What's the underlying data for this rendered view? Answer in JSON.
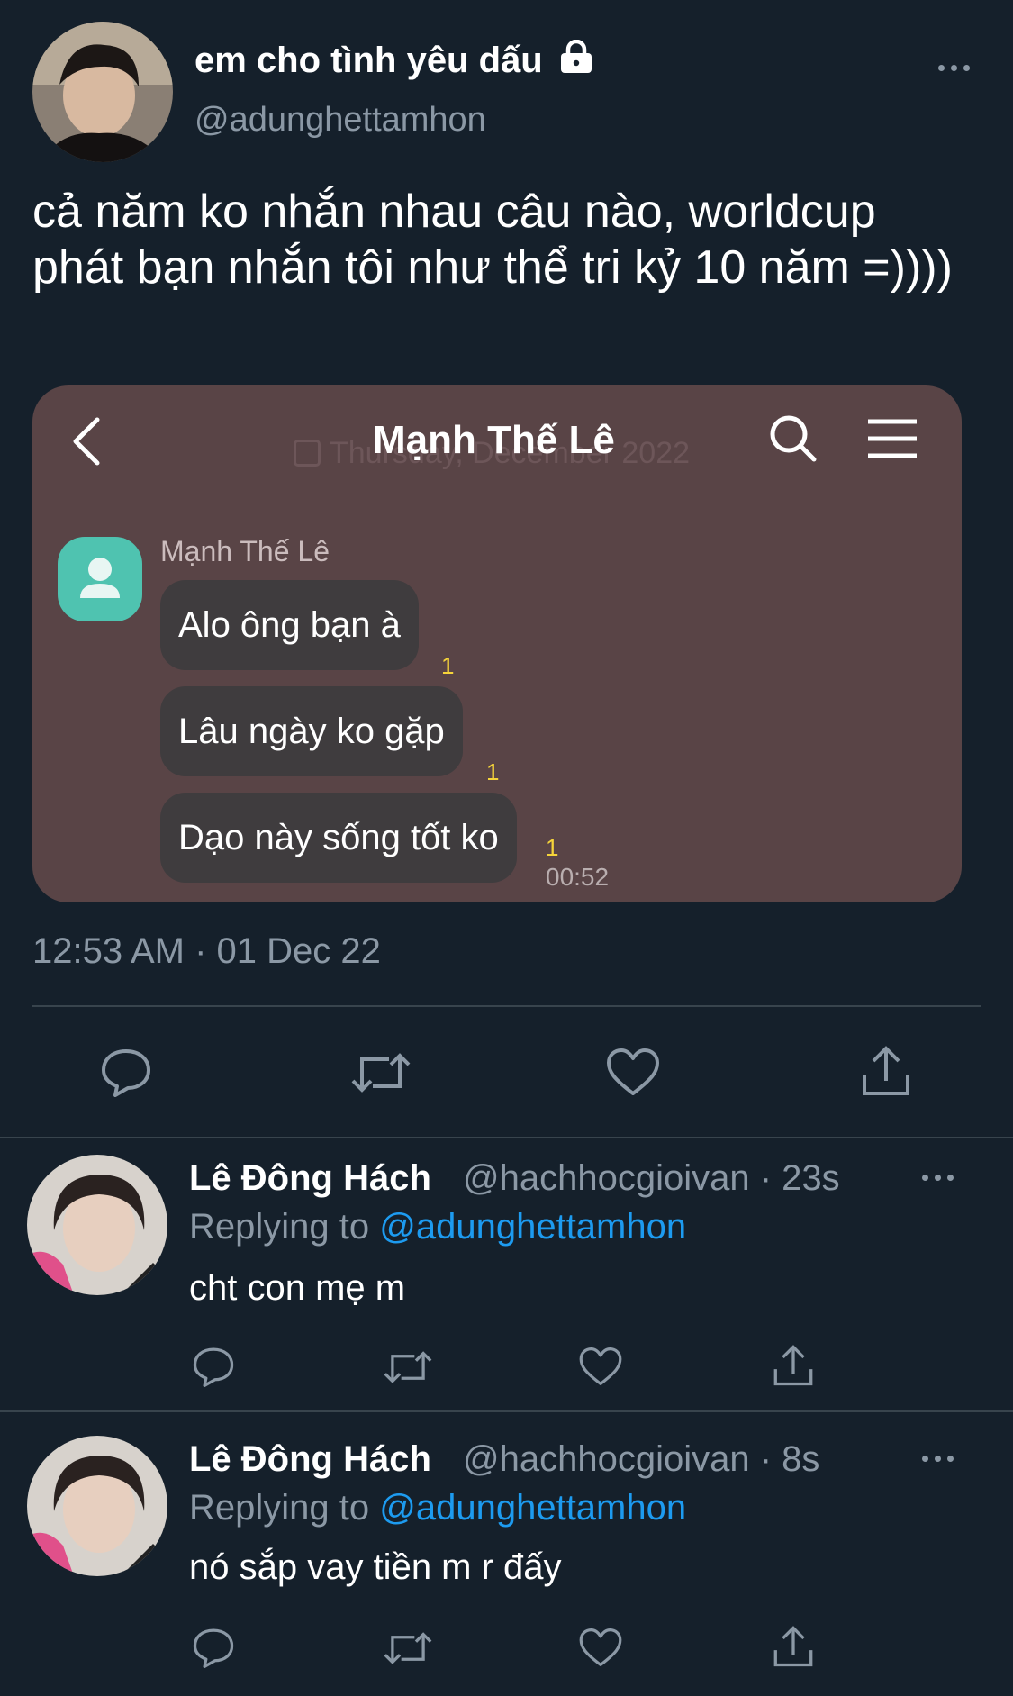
{
  "main_tweet": {
    "display_name": "em cho tình yêu dấu",
    "handle": "@adunghettamhon",
    "text": "cả năm ko nhắn nhau câu nào, worldcup phát bạn nhắn tôi như thể tri kỷ 10 năm =))))",
    "timestamp": "12:53 AM · 01 Dec 22",
    "icons": {
      "lock": "lock-icon",
      "more": "more-icon"
    }
  },
  "chat_screenshot": {
    "title": "Mạnh Thế Lê",
    "ghost_date": "Thursday, December 2022",
    "contact_name": "Mạnh Thế Lê",
    "messages": [
      {
        "text": "Alo ông bạn à",
        "unread": "1"
      },
      {
        "text": "Lâu ngày ko gặp",
        "unread": "1"
      },
      {
        "text": "Dạo này sống tốt ko",
        "unread": "1"
      }
    ],
    "last_time": "00:52",
    "colors": {
      "background": "#594446",
      "bubble": "#3f3c3e",
      "avatar": "#4fc3b0",
      "unread": "#f5d43a"
    }
  },
  "replies": [
    {
      "display_name": "Lê Đông Hách",
      "meta": "@hachhocgioivan · 23s",
      "replying_label": "Replying to",
      "replying_to": "@adunghettamhon",
      "text": "cht con mẹ m"
    },
    {
      "display_name": "Lê Đông Hách",
      "meta": "@hachhocgioivan · 8s",
      "replying_label": "Replying to",
      "replying_to": "@adunghettamhon",
      "text": "nó sắp vay tiền m r đấy"
    }
  ],
  "colors": {
    "background": "#15202b",
    "secondary_text": "#8b98a5",
    "link": "#1d9bf0",
    "divider": "#38444d"
  }
}
